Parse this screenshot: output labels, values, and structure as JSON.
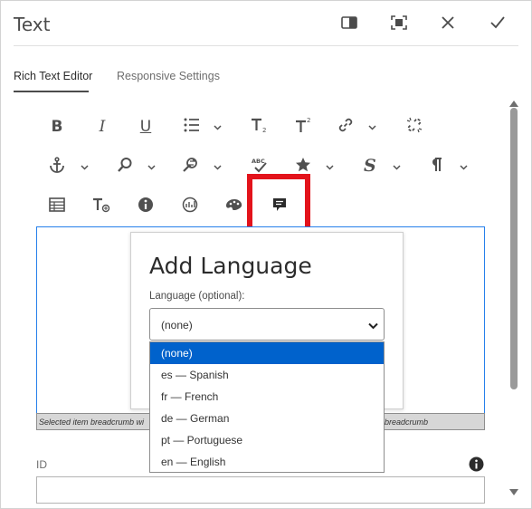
{
  "dialog": {
    "title": "Text",
    "header_buttons": [
      "toggle-side-panel-icon",
      "fullscreen-icon",
      "close-icon",
      "check-icon"
    ]
  },
  "tabs": [
    {
      "label": "Rich Text Editor",
      "active": true
    },
    {
      "label": "Responsive Settings",
      "active": false
    }
  ],
  "toolbar": {
    "rows": [
      [
        "bold",
        "italic",
        "underline",
        "list",
        "subscript",
        "superscript",
        "link",
        "unlink"
      ],
      [
        "anchor",
        "find",
        "find-replace",
        "spellcheck",
        "special-char",
        "styles",
        "paragraph-format"
      ],
      [
        "table",
        "text-formatting",
        "info",
        "chart",
        "palette",
        "language"
      ]
    ],
    "glyphs": {
      "bold": "B",
      "italic": "I",
      "underline": "U"
    },
    "highlighted": "language"
  },
  "editor": {
    "breadcrumb_left": "Selected item breadcrumb wi",
    "breadcrumb_right": "breadcrumb"
  },
  "modal": {
    "title": "Add Language",
    "field_label": "Language (optional):",
    "selected": "(none)",
    "options": [
      {
        "label": "(none)",
        "selected": true
      },
      {
        "label": "es — Spanish"
      },
      {
        "label": "fr — French"
      },
      {
        "label": "de — German"
      },
      {
        "label": "pt — Portuguese"
      },
      {
        "label": "en — English"
      }
    ]
  },
  "id_field": {
    "label": "ID",
    "value": ""
  },
  "colors": {
    "accent": "#2680eb",
    "highlight": "#e3131b",
    "selected_option": "#0062cc"
  }
}
